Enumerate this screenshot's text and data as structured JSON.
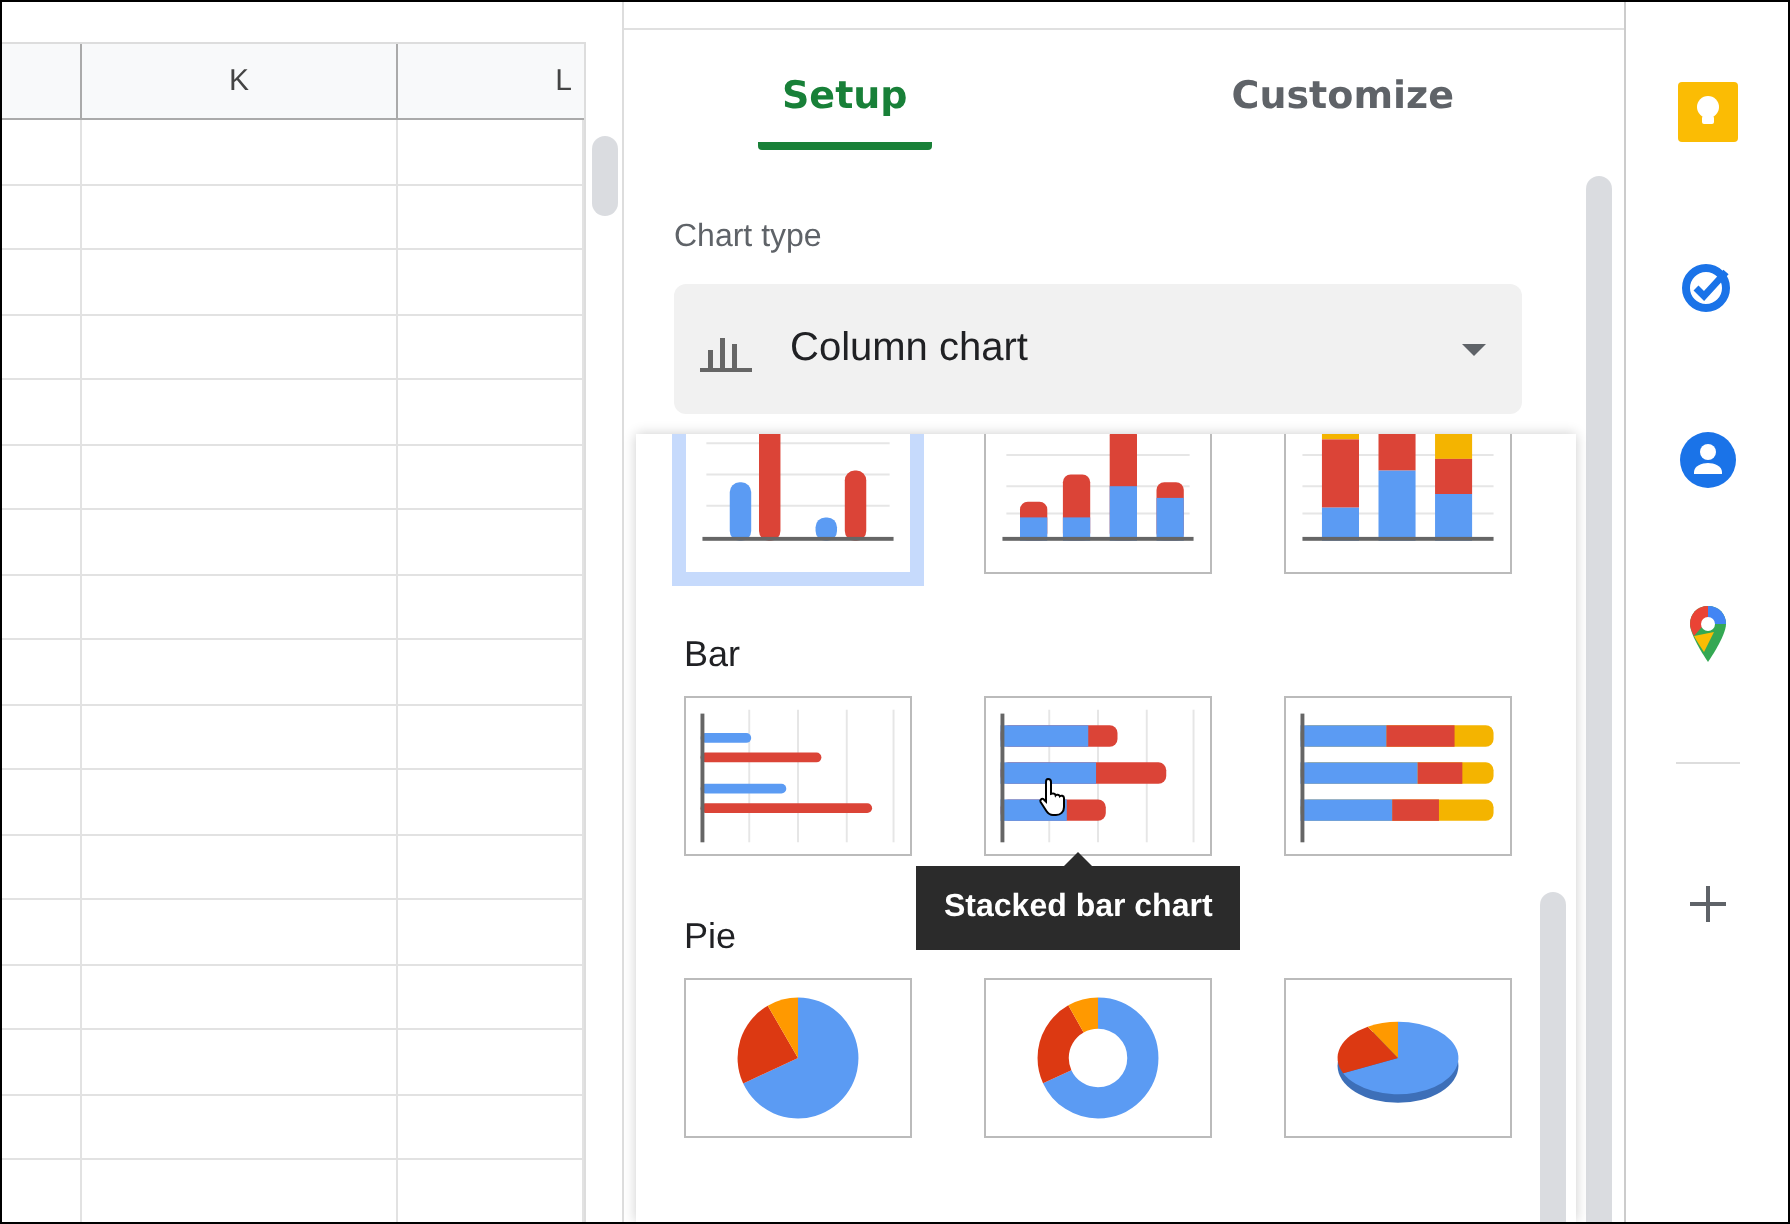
{
  "sheet": {
    "columns": [
      "",
      "K",
      "L"
    ]
  },
  "panel": {
    "tabs": [
      {
        "label": "Setup",
        "selected": true
      },
      {
        "label": "Customize",
        "selected": false
      }
    ],
    "chart_type": {
      "label": "Chart type",
      "value": "Column chart"
    },
    "chart_picker": {
      "groups": [
        {
          "thumbnails": [
            {
              "kind": "column",
              "selected": true,
              "hovered": false
            },
            {
              "kind": "stacked-column",
              "selected": false,
              "hovered": false
            },
            {
              "kind": "full-stacked-column",
              "selected": false,
              "hovered": false
            }
          ]
        },
        {
          "label": "Bar",
          "thumbnails": [
            {
              "kind": "bar",
              "selected": false,
              "hovered": false
            },
            {
              "kind": "stacked-bar",
              "selected": false,
              "hovered": true,
              "tooltip": "Stacked bar chart"
            },
            {
              "kind": "full-stacked-bar",
              "selected": false,
              "hovered": false
            }
          ]
        },
        {
          "label": "Pie",
          "thumbnails": [
            {
              "kind": "pie",
              "selected": false,
              "hovered": false
            },
            {
              "kind": "donut",
              "selected": false,
              "hovered": false
            },
            {
              "kind": "pie-3d",
              "selected": false,
              "hovered": false
            }
          ]
        }
      ]
    }
  }
}
